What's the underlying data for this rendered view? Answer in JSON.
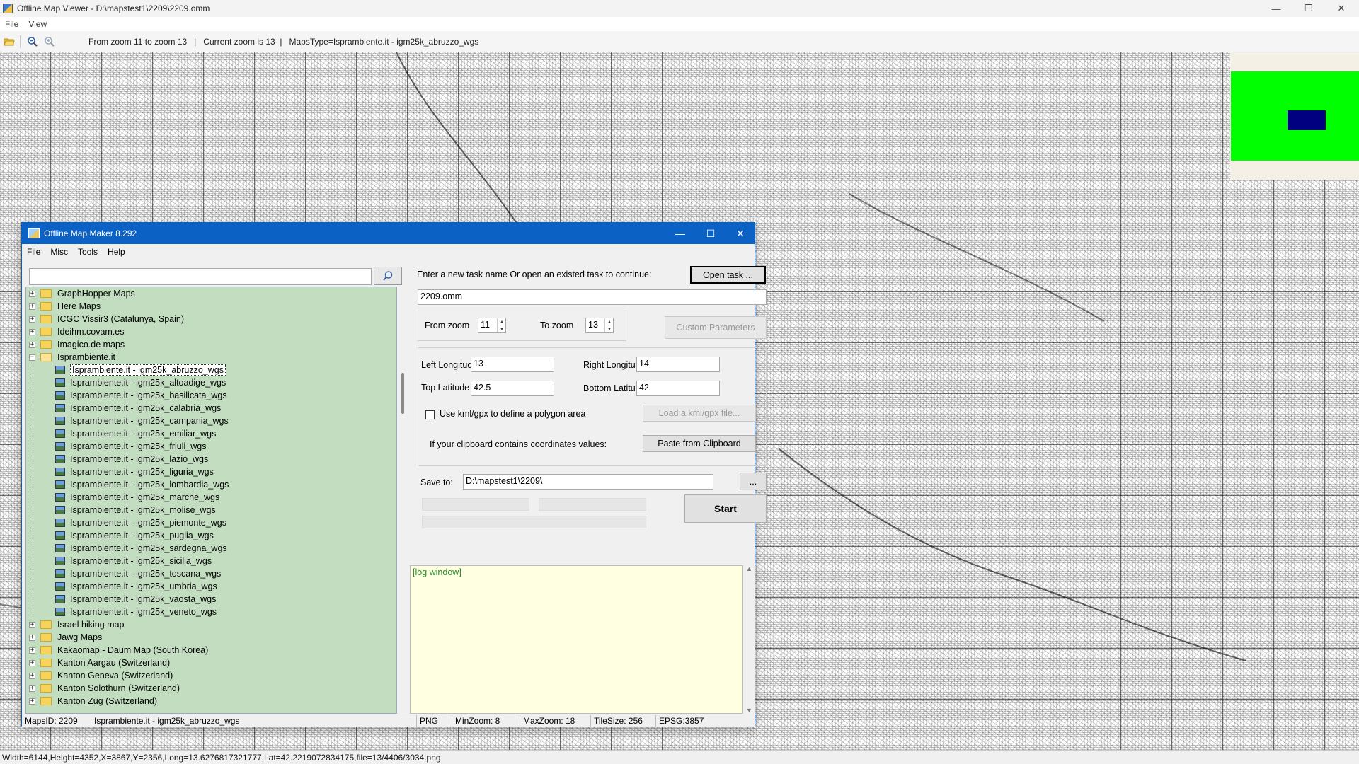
{
  "window": {
    "title": "Offline Map Viewer - D:\\mapstest1\\2209\\2209.omm",
    "controls": {
      "minimize": "—",
      "maximize": "❐",
      "close": "✕"
    }
  },
  "menu": {
    "file": "File",
    "view": "View"
  },
  "toolbar": {
    "info_zoom_range": "From zoom 11 to zoom 13",
    "sep1": "   |   ",
    "info_current_zoom": "Current zoom is 13",
    "sep2": "  |   ",
    "info_maps_type": "MapsType=Isprambiente.it - igm25k_abruzzo_wgs"
  },
  "minimap": {
    "bg_color": "#00ff00",
    "view_color": "#000080"
  },
  "statusbar": {
    "text": "Width=6144,Height=4352,X=3867,Y=2356,Long=13.6276817321777,Lat=42.2219072834175,file=13/4406/3034.png"
  },
  "dialog": {
    "title": "Offline Map Maker 8.292",
    "menu": {
      "file": "File",
      "misc": "Misc",
      "tools": "Tools",
      "help": "Help"
    },
    "search": {
      "value": "",
      "placeholder": ""
    },
    "tree": {
      "before": [
        "GraphHopper Maps",
        "Here Maps",
        "ICGC Vissir3 (Catalunya, Spain)",
        "Ideihm.covam.es",
        "Imagico.de maps"
      ],
      "open_folder": "Isprambiente.it",
      "children": [
        "Isprambiente.it - igm25k_abruzzo_wgs",
        "Isprambiente.it - igm25k_altoadige_wgs",
        "Isprambiente.it - igm25k_basilicata_wgs",
        "Isprambiente.it - igm25k_calabria_wgs",
        "Isprambiente.it - igm25k_campania_wgs",
        "Isprambiente.it - igm25k_emiliar_wgs",
        "Isprambiente.it - igm25k_friuli_wgs",
        "Isprambiente.it - igm25k_lazio_wgs",
        "Isprambiente.it - igm25k_liguria_wgs",
        "Isprambiente.it - igm25k_lombardia_wgs",
        "Isprambiente.it - igm25k_marche_wgs",
        "Isprambiente.it - igm25k_molise_wgs",
        "Isprambiente.it - igm25k_piemonte_wgs",
        "Isprambiente.it - igm25k_puglia_wgs",
        "Isprambiente.it - igm25k_sardegna_wgs",
        "Isprambiente.it - igm25k_sicilia_wgs",
        "Isprambiente.it - igm25k_toscana_wgs",
        "Isprambiente.it - igm25k_umbria_wgs",
        "Isprambiente.it - igm25k_vaosta_wgs",
        "Isprambiente.it - igm25k_veneto_wgs"
      ],
      "after": [
        "Israel hiking map",
        "Jawg Maps",
        "Kakaomap - Daum Map (South Korea)",
        "Kanton Aargau (Switzerland)",
        "Kanton Geneva (Switzerland)",
        "Kanton Solothurn (Switzerland)",
        "Kanton Zug (Switzerland)"
      ]
    },
    "task": {
      "prompt": "Enter a new task name Or open an existed task to continue:",
      "open_button": "Open task ...",
      "name_value": "2209.omm"
    },
    "zoom": {
      "from_label": "From zoom",
      "from_value": "11",
      "to_label": "To zoom",
      "to_value": "13",
      "custom_button": "Custom Parameters"
    },
    "coords": {
      "left_lon_label": "Left Longitude",
      "left_lon_value": "13",
      "right_lon_label": "Right Longitude",
      "right_lon_value": "14",
      "top_lat_label": "Top Latitude",
      "top_lat_value": "42.5",
      "bottom_lat_label": "Bottom Latitude",
      "bottom_lat_value": "42",
      "kml_checkbox_label": "Use kml/gpx to define a polygon area",
      "kml_checked": false,
      "load_kml_button": "Load a kml/gpx file...",
      "clipboard_label": "If your clipboard contains coordinates values:",
      "paste_button": "Paste from Clipboard"
    },
    "save": {
      "label": "Save to:",
      "path_value": "D:\\mapstest1\\2209\\",
      "browse_button": "...",
      "start_button": "Start"
    },
    "progress": {
      "bar1": 0,
      "bar2": 0,
      "bar3": 0
    },
    "log": {
      "text": "[log window]"
    },
    "status": {
      "maps_id": "MapsID: 2209",
      "maps_name": "Isprambiente.it - igm25k_abruzzo_wgs",
      "format": "PNG",
      "min_zoom": "MinZoom: 8",
      "max_zoom": "MaxZoom: 18",
      "tile_size": "TileSize: 256",
      "epsg": "EPSG:3857"
    }
  }
}
